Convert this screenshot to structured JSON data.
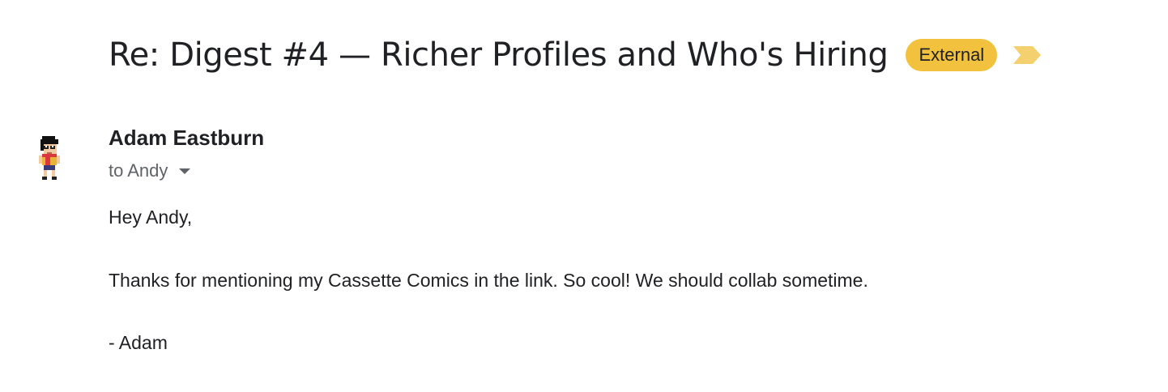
{
  "email": {
    "subject": "Re: Digest #4 — Richer Profiles and Who's Hiring",
    "label": "External",
    "importance_icon": "important-marker-icon",
    "sender": {
      "name": "Adam Eastburn",
      "avatar_icon": "pixel-character-avatar"
    },
    "recipients": "to Andy",
    "body": {
      "greeting": "Hey Andy,",
      "paragraph": "Thanks for mentioning my Cassette Comics in the link. So cool! We should collab sometime.",
      "signature": "- Adam"
    }
  },
  "colors": {
    "label_bg": "#f2c23e",
    "importance": "#f4d06f",
    "text_primary": "#202124",
    "text_secondary": "#5f6368"
  }
}
